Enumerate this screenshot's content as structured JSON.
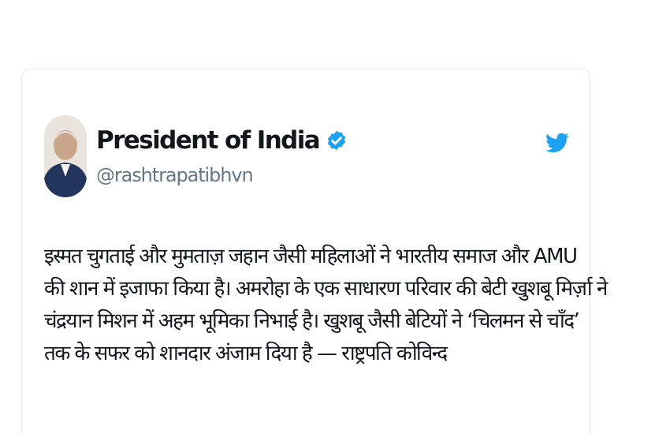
{
  "tweet": {
    "author": {
      "display_name": "President of India",
      "handle": "@rashtrapatibhvn",
      "verified": true,
      "avatar_icon": "portrait-avatar"
    },
    "platform_icon": "twitter-bird-icon",
    "text_lines": [
      "इस्मत चुगताई और मुमताज़ जहान जैसी महिलाओं ने भारतीय समाज और AMU",
      "की शान में इजाफा किया है। अमरोहा के एक साधारण परिवार की बेटी खुशबू मिर्ज़ा ने",
      "चंद्रयान मिशन में अहम भूमिका निभाई है। खुशबू जैसी बेटियों ने ‘चिलमन से चाँद’",
      "तक के सफर को शानदार अंजाम दिया है — राष्ट्रपति कोविन्द"
    ]
  },
  "colors": {
    "accent": "#1da1f2",
    "name_text": "#14171a",
    "handle_text": "#657786",
    "card_border": "#e1e8ed"
  }
}
